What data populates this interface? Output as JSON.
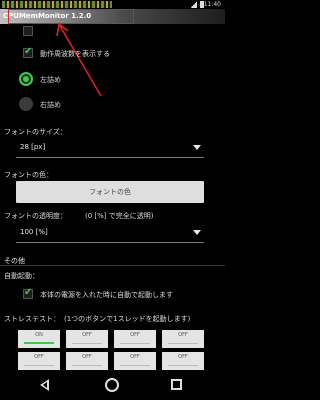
{
  "status_bar": {
    "time": "11:40"
  },
  "title_bar": {
    "title": "CPUMemMonitor 1.2.0"
  },
  "settings": {
    "partial_top_label": "",
    "show_cpu_freq_label": "動作周波数を表示する",
    "align_left_label": "左詰め",
    "align_right_label": "右詰め",
    "font_size_label": "フォントのサイズ：",
    "font_size_value": "28 [px]",
    "font_color_label": "フォントの色：",
    "font_color_button": "フォントの色",
    "font_opacity_label": "フォントの透明度：",
    "font_opacity_hint": "(0 [%] で完全に透明)",
    "font_opacity_value": "100 [%]",
    "other_section": "その他",
    "auto_start_label": "自動起動：",
    "auto_start_option": "本体の電源を入れた時に自動で起動します",
    "stress_test_label": "ストレステスト：",
    "stress_test_hint": "(1つのボタンで1スレッドを起動します)"
  },
  "stress_buttons": [
    {
      "label": "ON",
      "state": "on"
    },
    {
      "label": "OFF",
      "state": "off"
    },
    {
      "label": "OFF",
      "state": "off"
    },
    {
      "label": "OFF",
      "state": "off"
    },
    {
      "label": "OFF",
      "state": "off"
    },
    {
      "label": "OFF",
      "state": "off"
    },
    {
      "label": "OFF",
      "state": "off"
    },
    {
      "label": "OFF",
      "state": "off"
    }
  ],
  "colors": {
    "accent": "#3ec94a",
    "highlight": "#d22222"
  }
}
